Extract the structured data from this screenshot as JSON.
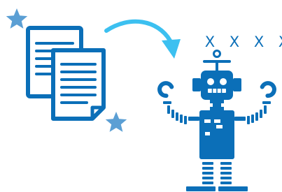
{
  "illustration": {
    "marks_text": "X X X X",
    "colors": {
      "primary": "#0b6fb8",
      "arrow": "#3cc0f0",
      "star": "#5b9fd4",
      "background": "#ffffff"
    },
    "icons": [
      "star-icon",
      "documents-icon",
      "curved-arrow-icon",
      "robot-icon"
    ]
  }
}
